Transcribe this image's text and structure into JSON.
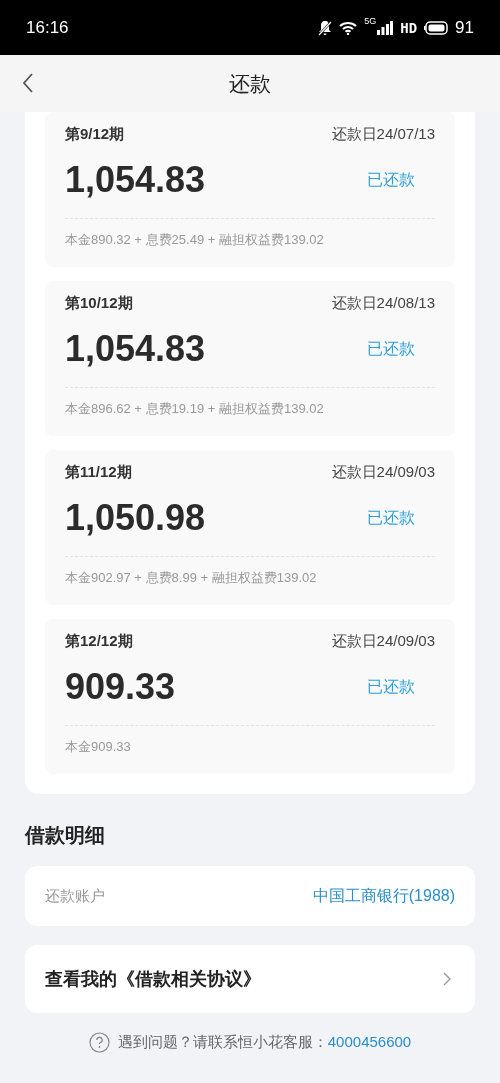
{
  "status_bar": {
    "time": "16:16",
    "network": "5G",
    "hd": "HD",
    "battery": "91"
  },
  "nav": {
    "title": "还款"
  },
  "installments": [
    {
      "period": "第9/12期",
      "due": "还款日24/07/13",
      "amount": "1,054.83",
      "status": "已还款",
      "breakdown": "本金890.32 + 息费25.49 + 融担权益费139.02"
    },
    {
      "period": "第10/12期",
      "due": "还款日24/08/13",
      "amount": "1,054.83",
      "status": "已还款",
      "breakdown": "本金896.62 + 息费19.19 + 融担权益费139.02"
    },
    {
      "period": "第11/12期",
      "due": "还款日24/09/03",
      "amount": "1,050.98",
      "status": "已还款",
      "breakdown": "本金902.97 + 息费8.99 + 融担权益费139.02"
    },
    {
      "period": "第12/12期",
      "due": "还款日24/09/03",
      "amount": "909.33",
      "status": "已还款",
      "breakdown": "本金909.33"
    }
  ],
  "loan_details": {
    "title": "借款明细",
    "account_label": "还款账户",
    "account_value": "中国工商银行(1988)",
    "agreement": "查看我的《借款相关协议》"
  },
  "help": {
    "text": "遇到问题？请联系恒小花客服：",
    "phone": "4000456600"
  }
}
